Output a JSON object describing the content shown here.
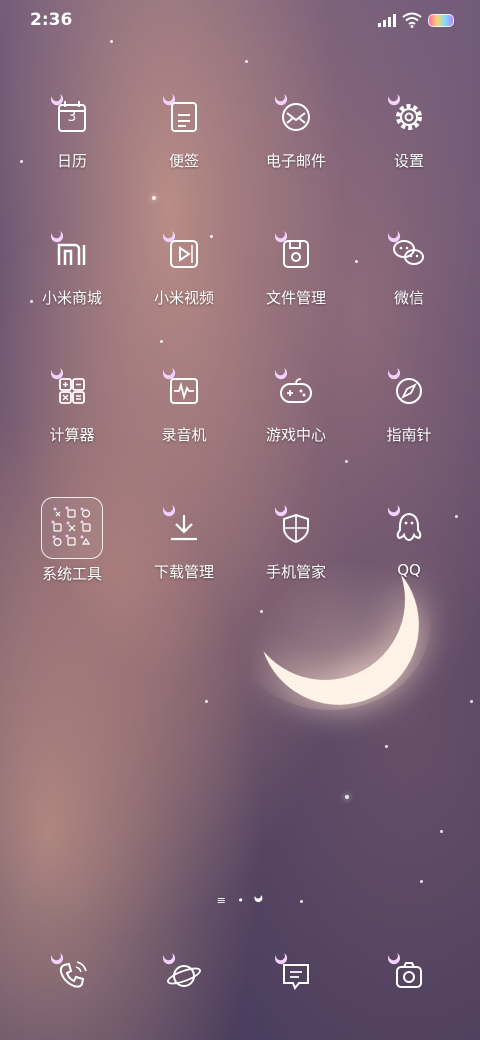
{
  "status_bar": {
    "time": "2:36"
  },
  "apps": [
    {
      "label": "日历",
      "icon": "calendar-icon",
      "date": "3"
    },
    {
      "label": "便签",
      "icon": "notes-icon"
    },
    {
      "label": "电子邮件",
      "icon": "mail-icon"
    },
    {
      "label": "设置",
      "icon": "settings-gear-icon"
    },
    {
      "label": "小米商城",
      "icon": "mi-store-icon"
    },
    {
      "label": "小米视频",
      "icon": "video-player-icon"
    },
    {
      "label": "文件管理",
      "icon": "folder-file-icon"
    },
    {
      "label": "微信",
      "icon": "wechat-icon"
    },
    {
      "label": "计算器",
      "icon": "calculator-icon"
    },
    {
      "label": "录音机",
      "icon": "recorder-waveform-icon"
    },
    {
      "label": "游戏中心",
      "icon": "gamepad-icon"
    },
    {
      "label": "指南针",
      "icon": "compass-icon"
    },
    {
      "label": "系统工具",
      "icon": "folder-icon"
    },
    {
      "label": "下载管理",
      "icon": "download-icon"
    },
    {
      "label": "手机管家",
      "icon": "shield-icon"
    },
    {
      "label": "QQ",
      "icon": "qq-penguin-icon"
    }
  ],
  "dock": [
    {
      "icon": "phone-icon"
    },
    {
      "icon": "browser-planet-icon"
    },
    {
      "icon": "messages-icon"
    },
    {
      "icon": "camera-icon"
    }
  ],
  "page_indicator": {
    "pages": 3,
    "current": 2
  },
  "colors": {
    "text": "#ffffff",
    "battery": [
      "#ff6aa8",
      "#ffd46a",
      "#7ce0ff",
      "#b78aff"
    ]
  }
}
